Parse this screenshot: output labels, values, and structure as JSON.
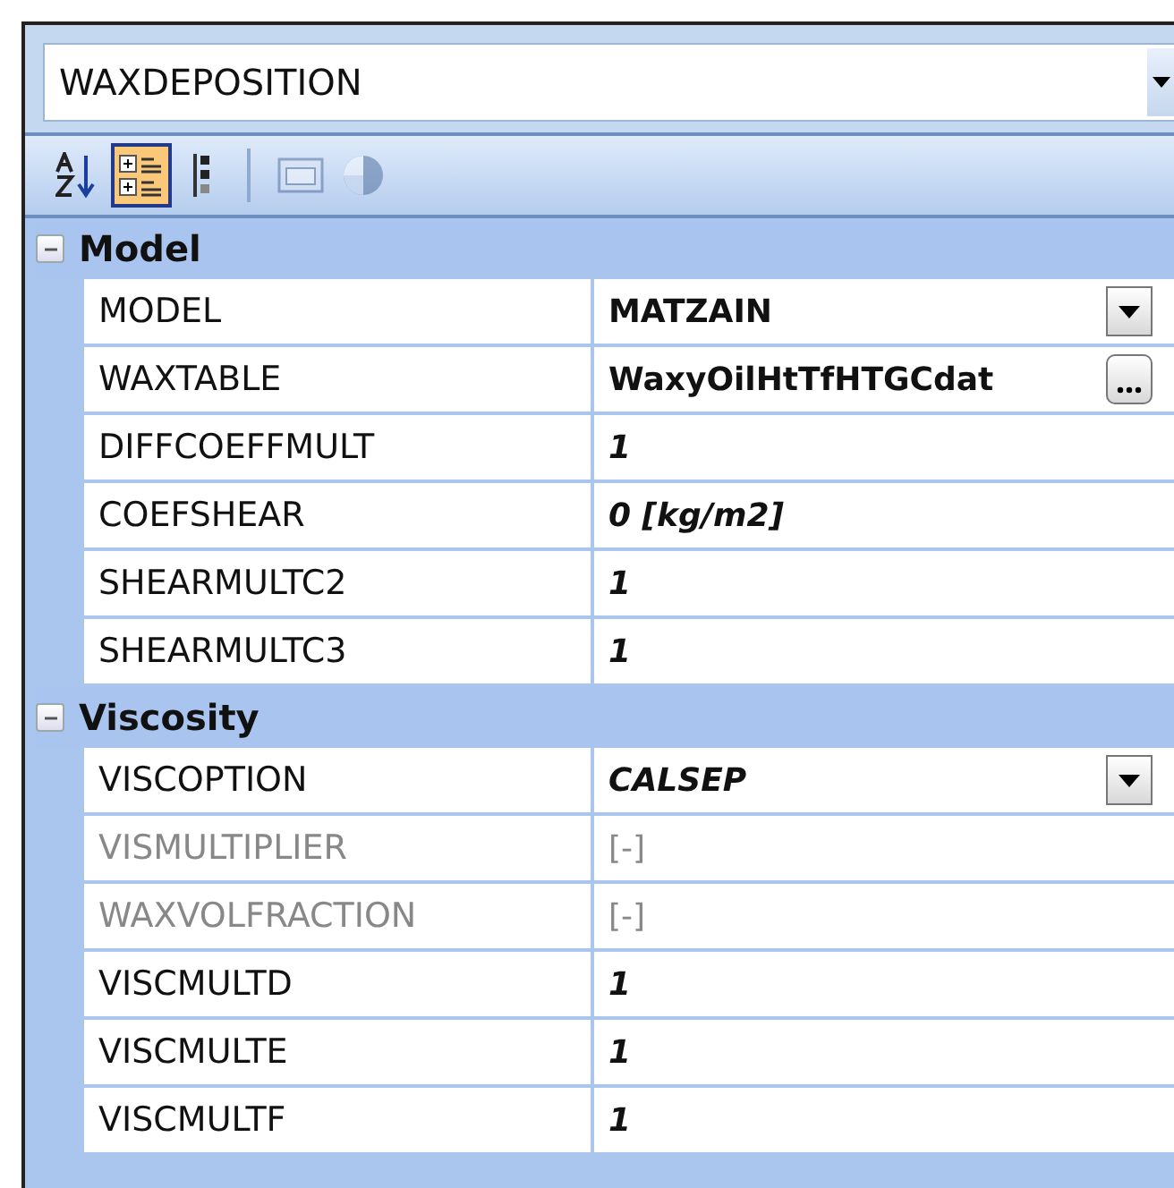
{
  "selector": {
    "value": "WAXDEPOSITION"
  },
  "toolbar": [
    {
      "kind": "sort-alpha",
      "selected": false,
      "disabled": false
    },
    {
      "kind": "categorized",
      "selected": true,
      "disabled": false
    },
    {
      "kind": "outline",
      "selected": false,
      "disabled": false
    },
    {
      "kind": "pages",
      "selected": false,
      "disabled": true
    },
    {
      "kind": "pie",
      "selected": false,
      "disabled": true
    }
  ],
  "groups": [
    {
      "title": "Model",
      "expanded": true,
      "rows": [
        {
          "name": "MODEL",
          "value": "MATZAIN",
          "italic": false,
          "disabled": false,
          "kind": "dropdown"
        },
        {
          "name": "WAXTABLE",
          "value": "WaxyOilHtTfHTGCdat",
          "italic": false,
          "disabled": false,
          "kind": "ellipsis"
        },
        {
          "name": "DIFFCOEFFMULT",
          "value": "1",
          "italic": true,
          "disabled": false,
          "kind": "text"
        },
        {
          "name": "COEFSHEAR",
          "value": "0 [kg/m2]",
          "italic": true,
          "disabled": false,
          "kind": "text"
        },
        {
          "name": "SHEARMULTC2",
          "value": "1",
          "italic": true,
          "disabled": false,
          "kind": "text"
        },
        {
          "name": "SHEARMULTC3",
          "value": "1",
          "italic": true,
          "disabled": false,
          "kind": "text"
        }
      ]
    },
    {
      "title": "Viscosity",
      "expanded": true,
      "rows": [
        {
          "name": "VISCOPTION",
          "value": "CALSEP",
          "italic": true,
          "disabled": false,
          "kind": "dropdown"
        },
        {
          "name": "VISMULTIPLIER",
          "value": "[-]",
          "italic": false,
          "disabled": true,
          "kind": "text"
        },
        {
          "name": "WAXVOLFRACTION",
          "value": "[-]",
          "italic": false,
          "disabled": true,
          "kind": "text"
        },
        {
          "name": "VISCMULTD",
          "value": "1",
          "italic": true,
          "disabled": false,
          "kind": "text"
        },
        {
          "name": "VISCMULTE",
          "value": "1",
          "italic": true,
          "disabled": false,
          "kind": "text"
        },
        {
          "name": "VISCMULTF",
          "value": "1",
          "italic": true,
          "disabled": false,
          "kind": "text"
        }
      ]
    }
  ]
}
